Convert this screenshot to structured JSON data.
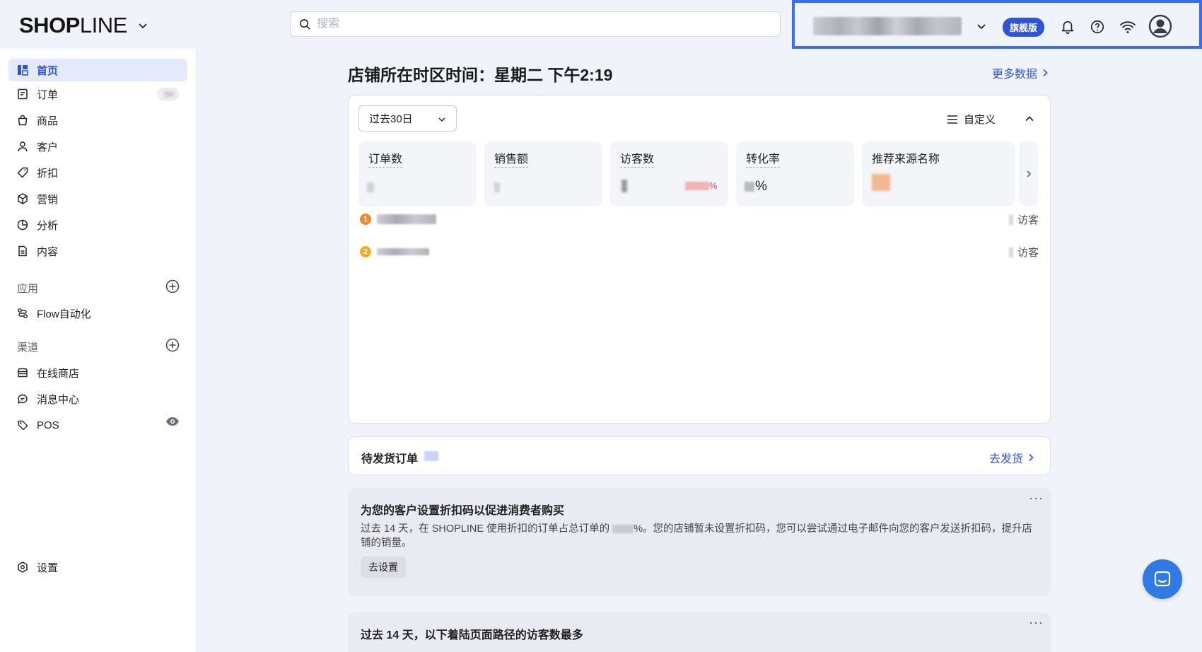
{
  "header": {
    "logo_bold": "SHOP",
    "logo_light": "LINE",
    "search_placeholder": "搜索",
    "plan_badge": "旗舰版"
  },
  "sidebar": {
    "items": [
      {
        "label": "首页",
        "icon": "dashboard-icon",
        "active": true
      },
      {
        "label": "订单",
        "icon": "order-icon"
      },
      {
        "label": "商品",
        "icon": "bag-icon"
      },
      {
        "label": "客户",
        "icon": "person-icon"
      },
      {
        "label": "折扣",
        "icon": "tag-icon"
      },
      {
        "label": "营销",
        "icon": "cube-icon"
      },
      {
        "label": "分析",
        "icon": "pie-icon"
      },
      {
        "label": "内容",
        "icon": "document-icon"
      }
    ],
    "apps_label": "应用",
    "apps": [
      {
        "label": "Flow自动化",
        "icon": "flow-icon"
      }
    ],
    "channels_label": "渠道",
    "channels": [
      {
        "label": "在线商店",
        "icon": "store-icon"
      },
      {
        "label": "消息中心",
        "icon": "chat-icon"
      },
      {
        "label": "POS",
        "icon": "pos-tag-icon"
      }
    ],
    "settings_label": "设置"
  },
  "main": {
    "title": "店铺所在时区时间：星期二 下午2:19",
    "more_data": "更多数据",
    "range_value": "过去30日",
    "customize_label": "自定义",
    "kpis": [
      "订单数",
      "销售额",
      "访客数",
      "转化率",
      "推荐来源名称"
    ],
    "kpi_percent": "%",
    "visitor_change_suffix": "%",
    "referrers": [
      {
        "rank": "1",
        "unit": "访客"
      },
      {
        "rank": "2",
        "unit": "访客"
      }
    ],
    "pending_title": "待发货订单",
    "ship_link": "去发货",
    "discount_card": {
      "title": "为您的客户设置折扣码以促进消费者购买",
      "desc_prefix": "过去 14 天，在 SHOPLINE 使用折扣的订单占总订单的",
      "desc_suffix": "%。您的店铺暂未设置折扣码，您可以尝试通过电子邮件向您的客户发送折扣码，提升店铺的销量。",
      "button": "去设置",
      "more": "···"
    },
    "landing_card": {
      "title": "过去 14 天，以下着陆页面路径的访客数最多",
      "more": "···"
    }
  },
  "colors": {
    "accent": "#2d56d6",
    "highlight_border": "#3a6df0",
    "rank1": "#ef8c2e",
    "rank2": "#f0ad2c",
    "negative": "#d9534f"
  }
}
